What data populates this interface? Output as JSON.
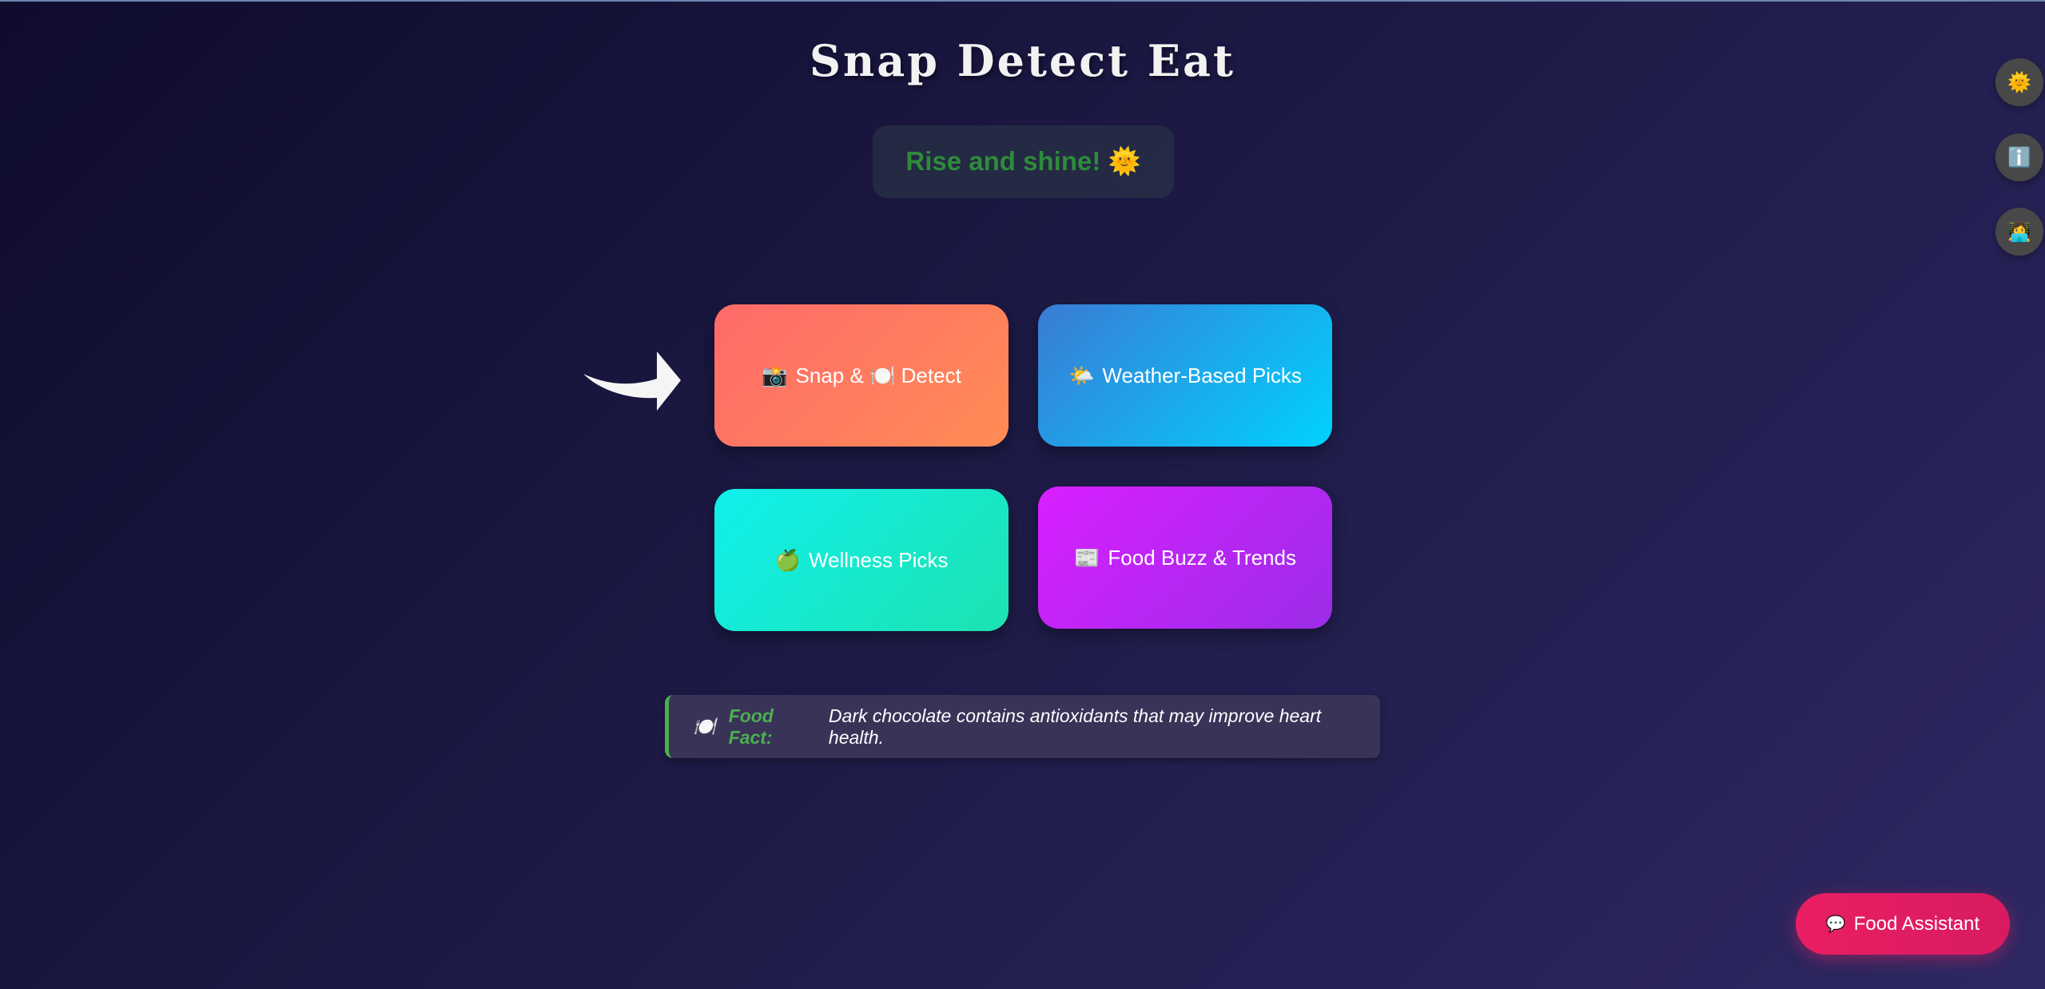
{
  "header": {
    "title": "Snap Detect Eat",
    "greeting": "Rise and shine! 🌞"
  },
  "cards": [
    {
      "icon": "camera-icon",
      "glyph": "📸",
      "label": "Snap & 🍽️ Detect"
    },
    {
      "icon": "sun-behind-cloud-icon",
      "glyph": "🌤️",
      "label": "Weather-Based Picks"
    },
    {
      "icon": "apple-icon",
      "glyph": "🍏",
      "label": "Wellness Picks"
    },
    {
      "icon": "newspaper-icon",
      "glyph": "📰",
      "label": "Food Buzz & Trends"
    }
  ],
  "fact": {
    "icon": "plate-icon",
    "glyph": "🍽️",
    "label": "Food Fact:",
    "text": "Dark chocolate contains antioxidants that may improve heart health."
  },
  "side_buttons": [
    {
      "icon": "sun-icon",
      "glyph": "🌞"
    },
    {
      "icon": "info-icon",
      "glyph": "ℹ️"
    },
    {
      "icon": "technologist-icon",
      "glyph": "👩‍💻"
    }
  ],
  "assistant": {
    "icon": "speech-bubble-icon",
    "glyph": "💬",
    "label": "Food Assistant"
  },
  "colors": {
    "accent_green": "#4caf50",
    "greeting_green": "#2e8b3a",
    "assistant_pink": "#e91e63"
  }
}
